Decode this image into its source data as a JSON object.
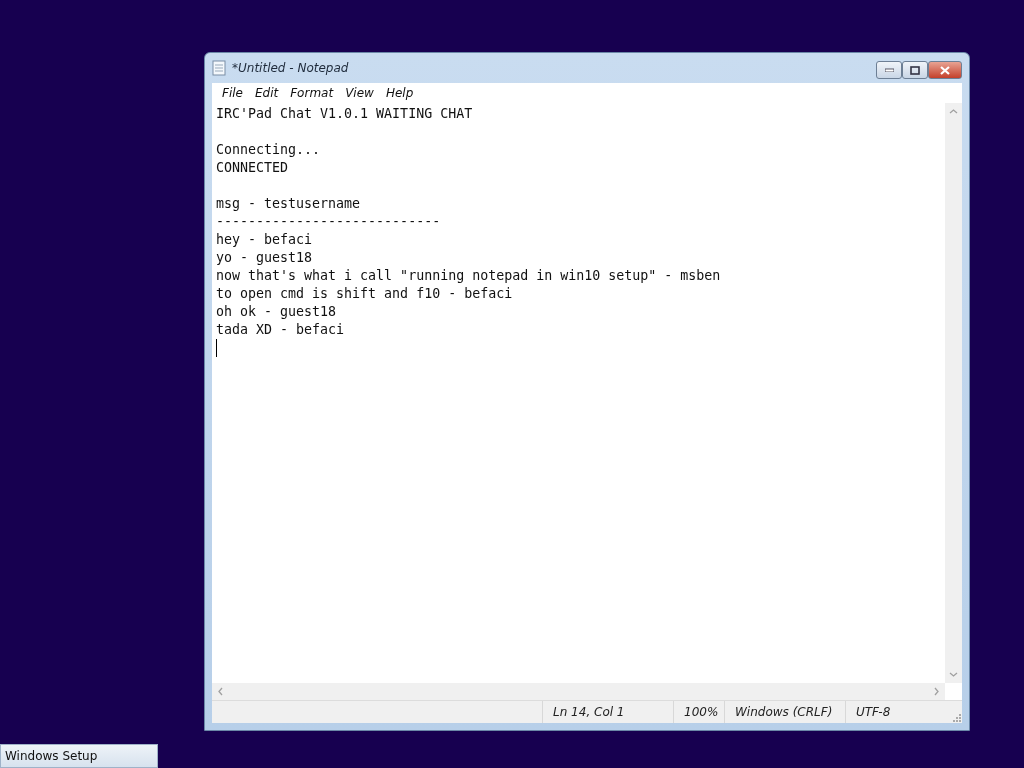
{
  "window": {
    "title": "*Untitled - Notepad"
  },
  "menu": [
    "File",
    "Edit",
    "Format",
    "View",
    "Help"
  ],
  "document": {
    "paragraphs": [
      [
        "IRC'Pad Chat V1.0.1 WAITING CHAT"
      ],
      [
        "Connecting...",
        "CONNECTED"
      ],
      [
        "msg - testusername",
        "----------------------------",
        "hey - befaci",
        "yo - guest18",
        "now that's what i call \"running notepad in win10 setup\" - msben",
        "to open cmd is shift and f10 - befaci",
        "oh ok - guest18",
        "tada XD - befaci"
      ]
    ]
  },
  "status_bar": {
    "position": "Ln 14, Col 1",
    "zoom": "100%",
    "line_ending": "Windows (CRLF)",
    "encoding": "UTF-8"
  },
  "taskbar": {
    "items": [
      {
        "label": "Windows Setup"
      }
    ]
  }
}
